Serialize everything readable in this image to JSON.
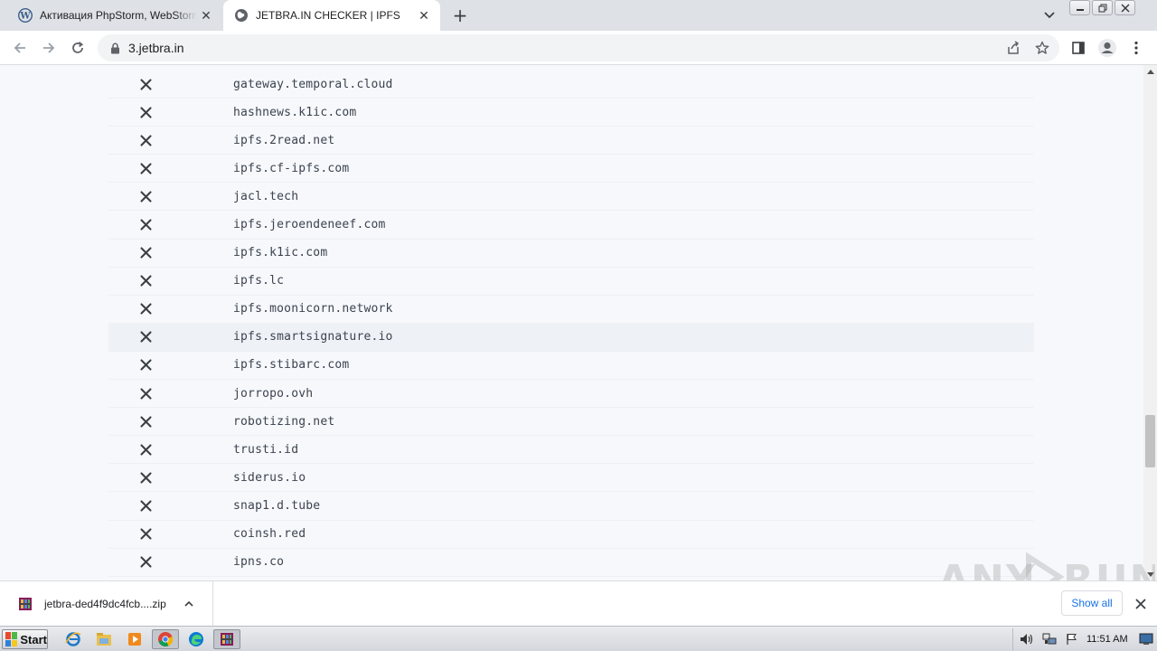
{
  "browser": {
    "tabs": [
      {
        "title": "Активация PhpStorm, WebStorm, IntelliJ"
      },
      {
        "title": "JETBRA.IN CHECKER | IPFS"
      }
    ],
    "url": "3.jetbra.in"
  },
  "gateways": [
    {
      "domain": "gateway.temporal.cloud",
      "status": "failed"
    },
    {
      "domain": "hashnews.k1ic.com",
      "status": "failed"
    },
    {
      "domain": "ipfs.2read.net",
      "status": "failed"
    },
    {
      "domain": "ipfs.cf-ipfs.com",
      "status": "failed"
    },
    {
      "domain": "jacl.tech",
      "status": "failed"
    },
    {
      "domain": "ipfs.jeroendeneef.com",
      "status": "failed"
    },
    {
      "domain": "ipfs.k1ic.com",
      "status": "failed"
    },
    {
      "domain": "ipfs.lc",
      "status": "failed"
    },
    {
      "domain": "ipfs.moonicorn.network",
      "status": "failed"
    },
    {
      "domain": "ipfs.smartsignature.io",
      "status": "failed"
    },
    {
      "domain": "ipfs.stibarc.com",
      "status": "failed"
    },
    {
      "domain": "jorropo.ovh",
      "status": "failed"
    },
    {
      "domain": "robotizing.net",
      "status": "failed"
    },
    {
      "domain": "trusti.id",
      "status": "failed"
    },
    {
      "domain": "siderus.io",
      "status": "failed"
    },
    {
      "domain": "snap1.d.tube",
      "status": "failed"
    },
    {
      "domain": "coinsh.red",
      "status": "failed"
    },
    {
      "domain": "ipns.co",
      "status": "failed"
    }
  ],
  "download": {
    "filename": "jetbra-ded4f9dc4fcb....zip",
    "show_all": "Show all"
  },
  "watermark": "ANY RUN",
  "taskbar": {
    "start": "Start",
    "clock": "11:51 AM"
  },
  "colors": {
    "content_bg": "#f6f8fb",
    "fail_icon": "#3c4043",
    "link_blue": "#1a73e8"
  }
}
